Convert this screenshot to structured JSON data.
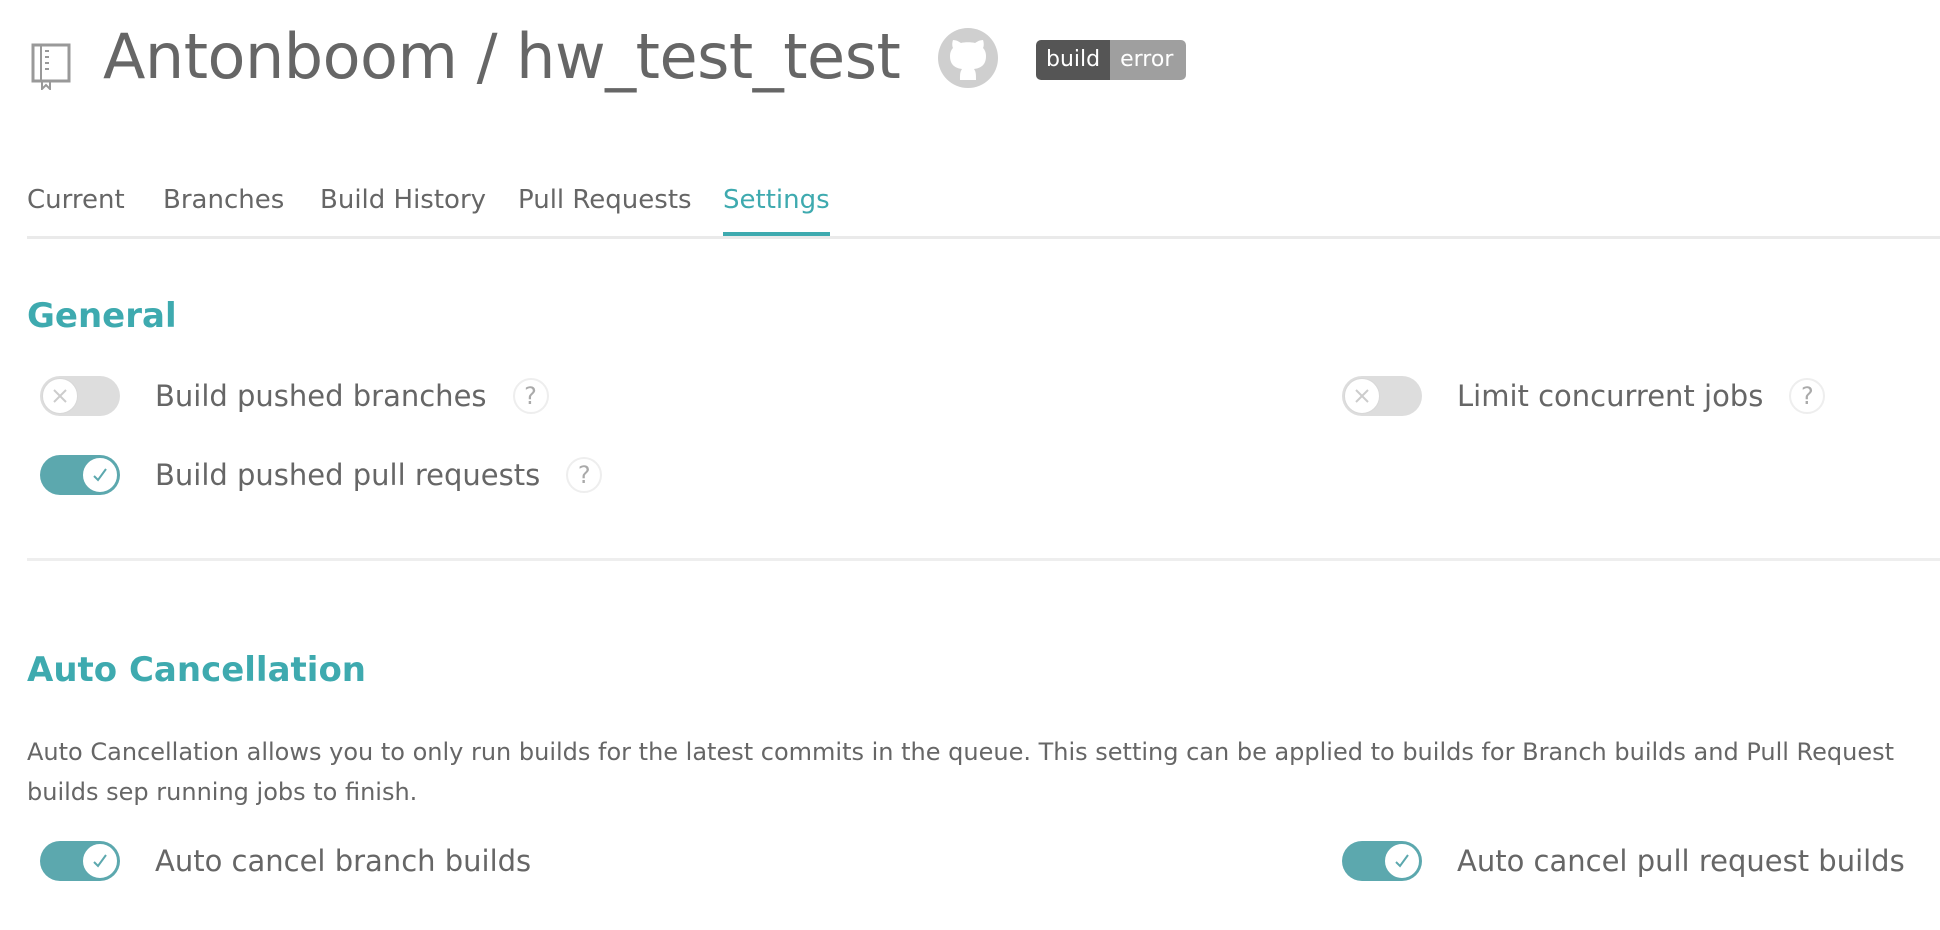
{
  "header": {
    "repo_title": "Antonboom / hw_test_test",
    "badge": {
      "left": "build",
      "right": "error"
    }
  },
  "tabs": [
    {
      "label": "Current",
      "active": false
    },
    {
      "label": "Branches",
      "active": false
    },
    {
      "label": "Build History",
      "active": false
    },
    {
      "label": "Pull Requests",
      "active": false
    },
    {
      "label": "Settings",
      "active": true
    }
  ],
  "general": {
    "title": "General",
    "settings": {
      "build_pushed_branches": {
        "label": "Build pushed branches",
        "enabled": false,
        "help": "?"
      },
      "build_pushed_pull_requests": {
        "label": "Build pushed pull requests",
        "enabled": true,
        "help": "?"
      },
      "limit_concurrent_jobs": {
        "label": "Limit concurrent jobs",
        "enabled": false,
        "help": "?"
      }
    }
  },
  "auto_cancellation": {
    "title": "Auto Cancellation",
    "description": "Auto Cancellation allows you to only run builds for the latest commits in the queue. This setting can be applied to builds for Branch builds and Pull Request builds sep running jobs to finish.",
    "settings": {
      "auto_cancel_branch_builds": {
        "label": "Auto cancel branch builds",
        "enabled": true
      },
      "auto_cancel_pull_request_builds": {
        "label": "Auto cancel pull request builds",
        "enabled": true
      }
    }
  },
  "colors": {
    "accent": "#3eaaaf",
    "toggle_on": "#5ca8ae",
    "toggle_off": "#dddddd",
    "text": "#666666",
    "badge_dark": "#555555",
    "badge_light": "#9f9f9f"
  },
  "icons": {
    "repo": "repo-book-icon",
    "github": "github-icon",
    "toggle_off": "x-icon",
    "toggle_on": "check-icon",
    "help": "question-icon"
  }
}
